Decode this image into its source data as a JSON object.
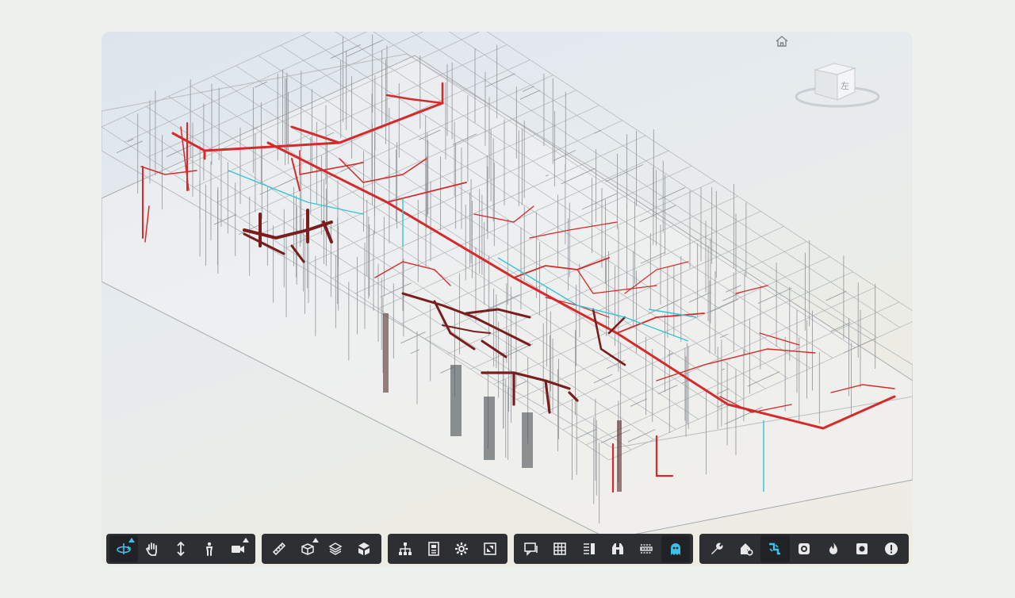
{
  "viewer": {
    "background_top": "#dde5ec",
    "background_bottom": "#efece2",
    "pipe_color": "#d62a2a",
    "duct_color": "#7a1d1d",
    "water_color": "#35c3d6",
    "wireframe_color": "#a9adb1"
  },
  "navigation": {
    "home_icon": "home-icon",
    "viewcube_face_label": "左"
  },
  "toolbar": {
    "accent_color": "#3ec0e8",
    "groups": [
      {
        "name": "navigation-tools",
        "tools": [
          "orbit-icon",
          "pan-icon",
          "zoom-icon",
          "first-person-icon",
          "camera-icon"
        ]
      },
      {
        "name": "model-tools",
        "tools": [
          "measure-icon",
          "section-box-icon",
          "layers-icon",
          "explode-icon"
        ]
      },
      {
        "name": "settings-tools",
        "tools": [
          "model-browser-icon",
          "properties-icon",
          "settings-icon",
          "fullscreen-icon"
        ]
      },
      {
        "name": "review-tools",
        "tools": [
          "comment-icon",
          "grid-icon",
          "sheets-icon",
          "binoculars-icon",
          "clipping-icon",
          "ghost-icon"
        ]
      },
      {
        "name": "analysis-tools",
        "tools": [
          "wrench-icon",
          "clash-icon",
          "route-icon",
          "disc-icon",
          "fire-icon",
          "target-icon",
          "alert-icon"
        ]
      }
    ]
  }
}
